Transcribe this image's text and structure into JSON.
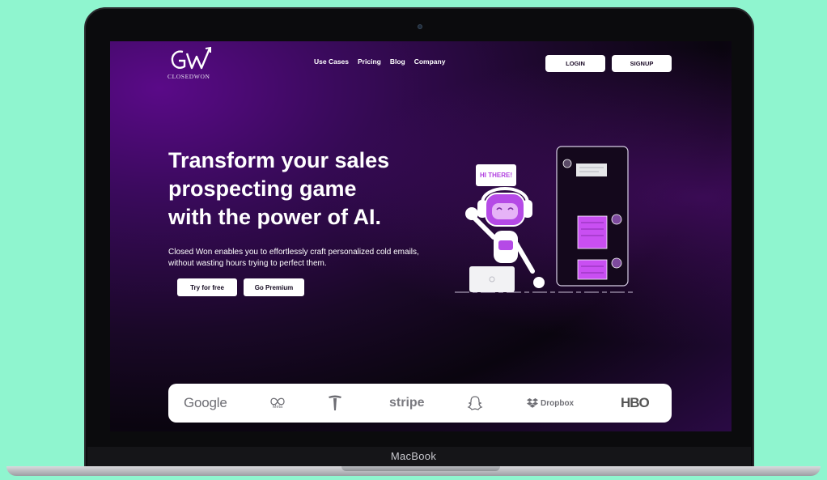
{
  "device": {
    "label": "MacBook"
  },
  "brand": {
    "name": "CLOSEDWON",
    "logo_icon": "gw-arrow-logo"
  },
  "nav": {
    "items": [
      "Use Cases",
      "Pricing",
      "Blog",
      "Company"
    ]
  },
  "auth": {
    "login": "LOGIN",
    "signup": "SIGNUP"
  },
  "hero": {
    "title_line1": "Transform your sales",
    "title_line2": "prospecting game",
    "title_line3": "with the power of AI.",
    "subtitle": "Closed Won enables you to effortlessly craft personalized cold emails, without wasting hours trying to perfect them.",
    "cta_primary": "Try for free",
    "cta_secondary": "Go Premium",
    "speech_bubble": "HI THERE!"
  },
  "partners": {
    "google": "Google",
    "meta": "Meta",
    "stripe": "stripe",
    "dropbox": "Dropbox",
    "hbo": "HBO",
    "icons": [
      "google-logo",
      "meta-logo",
      "tesla-logo",
      "stripe-logo",
      "snapchat-logo",
      "dropbox-logo",
      "hbo-logo"
    ]
  },
  "colors": {
    "background": "#8ff5cf",
    "hero_purple": "#5a0a88",
    "accent": "#b13fe0"
  }
}
